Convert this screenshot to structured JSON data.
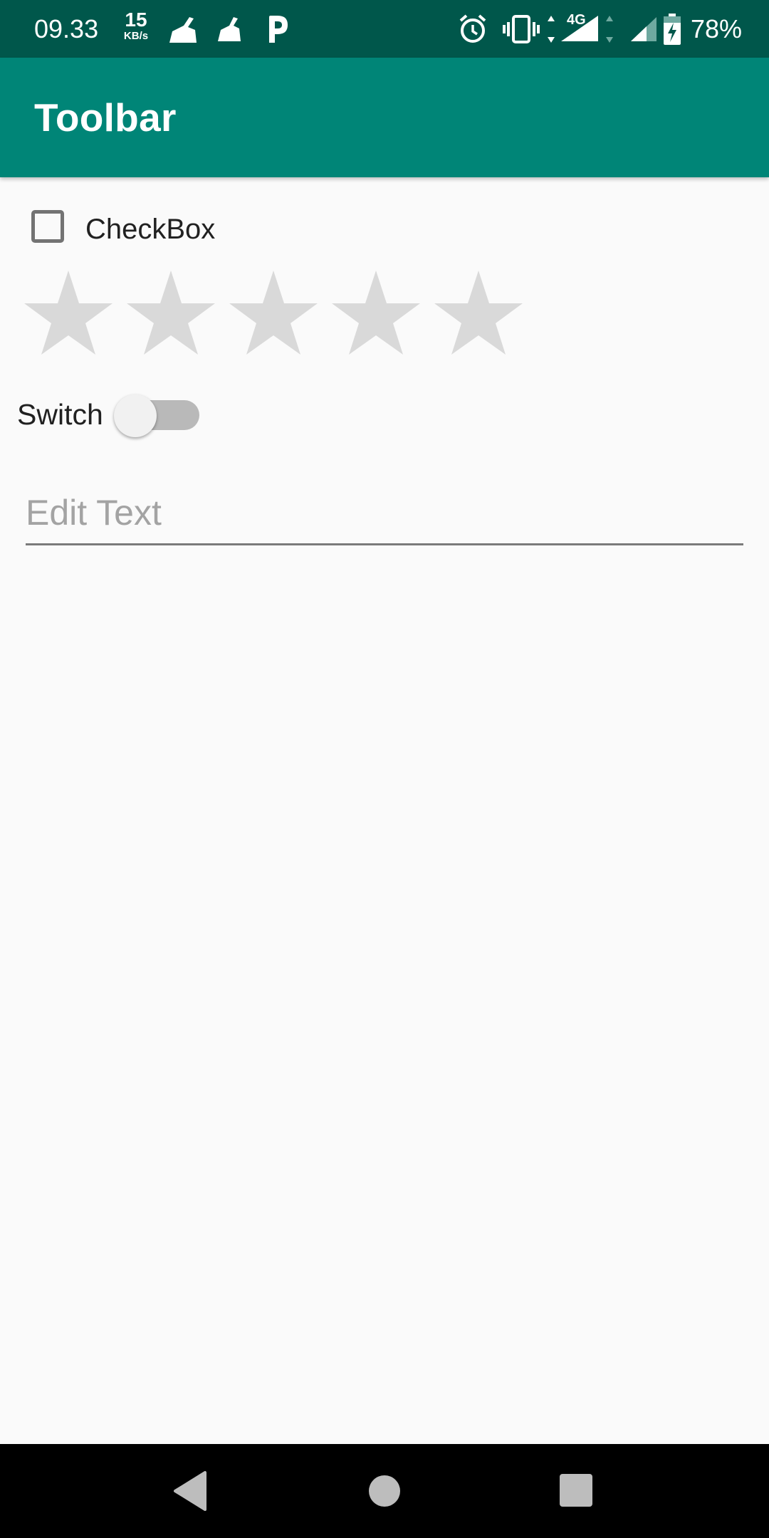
{
  "status_bar": {
    "time": "09.33",
    "net_speed_value": "15",
    "net_speed_unit": "KB/s",
    "network_type": "4G",
    "battery_percent": "78%",
    "icons": [
      "broom-icon",
      "cleaner-icon",
      "p-icon",
      "alarm-icon",
      "vibrate-icon",
      "signal-4g-icon",
      "signal-icon",
      "battery-charging-icon"
    ]
  },
  "toolbar": {
    "title": "Toolbar",
    "color": "#008577"
  },
  "checkbox": {
    "label": "CheckBox",
    "checked": false
  },
  "rating": {
    "max": 5,
    "value": 0,
    "empty_color": "#D9D9D9"
  },
  "switch": {
    "label": "Switch",
    "on": false
  },
  "edit_text": {
    "placeholder": "Edit Text",
    "value": ""
  },
  "nav_bar": {
    "buttons": [
      "back",
      "home",
      "recents"
    ]
  },
  "colors": {
    "status_bar": "#00574B",
    "accent": "#008577",
    "background": "#FAFAFA"
  }
}
